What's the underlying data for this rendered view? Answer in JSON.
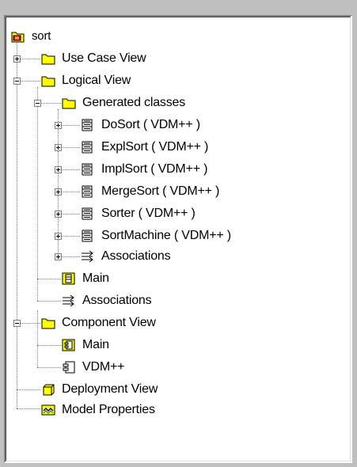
{
  "tree": {
    "root": {
      "label": "sort",
      "icon": "model-root-icon"
    },
    "nodes": [
      {
        "id": "use-case-view",
        "label": "Use Case View",
        "icon": "folder-icon",
        "expander": "plus"
      },
      {
        "id": "logical-view",
        "label": "Logical View",
        "icon": "folder-icon",
        "expander": "minus"
      },
      {
        "id": "generated-classes",
        "label": "Generated classes",
        "icon": "folder-icon",
        "expander": "minus"
      },
      {
        "id": "dosort",
        "label": "DoSort ( VDM++ )",
        "icon": "class-icon",
        "expander": "plus"
      },
      {
        "id": "explsort",
        "label": "ExplSort ( VDM++ )",
        "icon": "class-icon",
        "expander": "plus"
      },
      {
        "id": "implsort",
        "label": "ImplSort ( VDM++ )",
        "icon": "class-icon",
        "expander": "plus"
      },
      {
        "id": "mergesort",
        "label": "MergeSort ( VDM++ )",
        "icon": "class-icon",
        "expander": "plus"
      },
      {
        "id": "sorter",
        "label": "Sorter ( VDM++ )",
        "icon": "class-icon",
        "expander": "plus"
      },
      {
        "id": "sortmachine",
        "label": "SortMachine ( VDM++ )",
        "icon": "class-icon",
        "expander": "plus"
      },
      {
        "id": "associations-inner",
        "label": "Associations",
        "icon": "associations-icon",
        "expander": "plus"
      },
      {
        "id": "main-logical",
        "label": "Main",
        "icon": "class-diagram-icon",
        "expander": null
      },
      {
        "id": "associations-logical",
        "label": "Associations",
        "icon": "associations-icon",
        "expander": null
      },
      {
        "id": "component-view",
        "label": "Component View",
        "icon": "folder-icon",
        "expander": "minus"
      },
      {
        "id": "main-component",
        "label": "Main",
        "icon": "component-diagram-icon",
        "expander": null
      },
      {
        "id": "vdmpp-component",
        "label": "VDM++",
        "icon": "component-icon",
        "expander": null
      },
      {
        "id": "deployment-view",
        "label": "Deployment View",
        "icon": "deployment-icon",
        "expander": null
      },
      {
        "id": "model-properties",
        "label": "Model Properties",
        "icon": "model-properties-icon",
        "expander": null
      }
    ]
  },
  "colors": {
    "folder_yellow": "#ffff00",
    "folder_outline": "#000000",
    "background": "#c0c0c0"
  }
}
